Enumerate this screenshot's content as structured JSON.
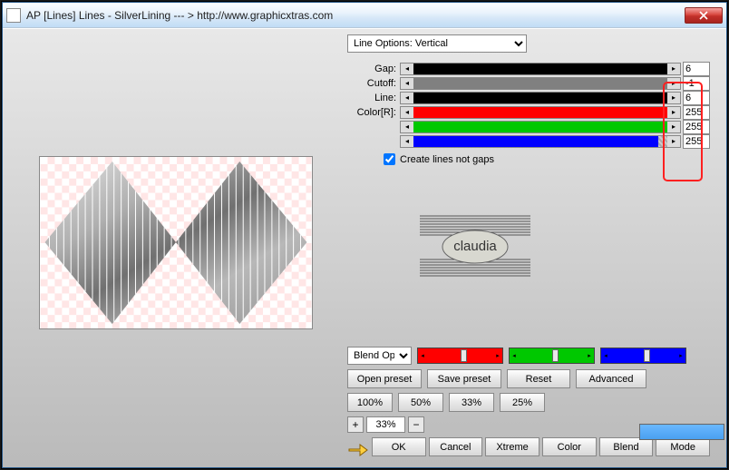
{
  "window": {
    "title": "AP [Lines]  Lines - SilverLining   --- >  http://www.graphicxtras.com"
  },
  "dropdown": {
    "line_options": "Line Options: Vertical"
  },
  "sliders": {
    "gap": {
      "label": "Gap:",
      "value": "6"
    },
    "cutoff": {
      "label": "Cutoff:",
      "value": "-1"
    },
    "line": {
      "label": "Line:",
      "value": "6"
    },
    "r": {
      "label": "Color[R]:",
      "value": "255"
    },
    "g": {
      "label": "",
      "value": "255"
    },
    "b": {
      "label": "",
      "value": "255"
    }
  },
  "checkbox": {
    "create_lines": "Create lines not gaps",
    "checked": true
  },
  "logo_text": "claudia",
  "blend_combo": "Blend Optic",
  "preset_buttons": {
    "open": "Open preset",
    "save": "Save preset",
    "reset": "Reset",
    "advanced": "Advanced"
  },
  "zoom_buttons": {
    "z100": "100%",
    "z50": "50%",
    "z33": "33%",
    "z25": "25%"
  },
  "zoom_current": "33%",
  "actions": {
    "ok": "OK",
    "cancel": "Cancel",
    "xtreme": "Xtreme",
    "color": "Color",
    "blend": "Blend",
    "mode": "Mode"
  },
  "colors": {
    "red": "#ff0000",
    "green": "#00c800",
    "blue": "#0000ff",
    "swatch": "#5aa8f8"
  }
}
